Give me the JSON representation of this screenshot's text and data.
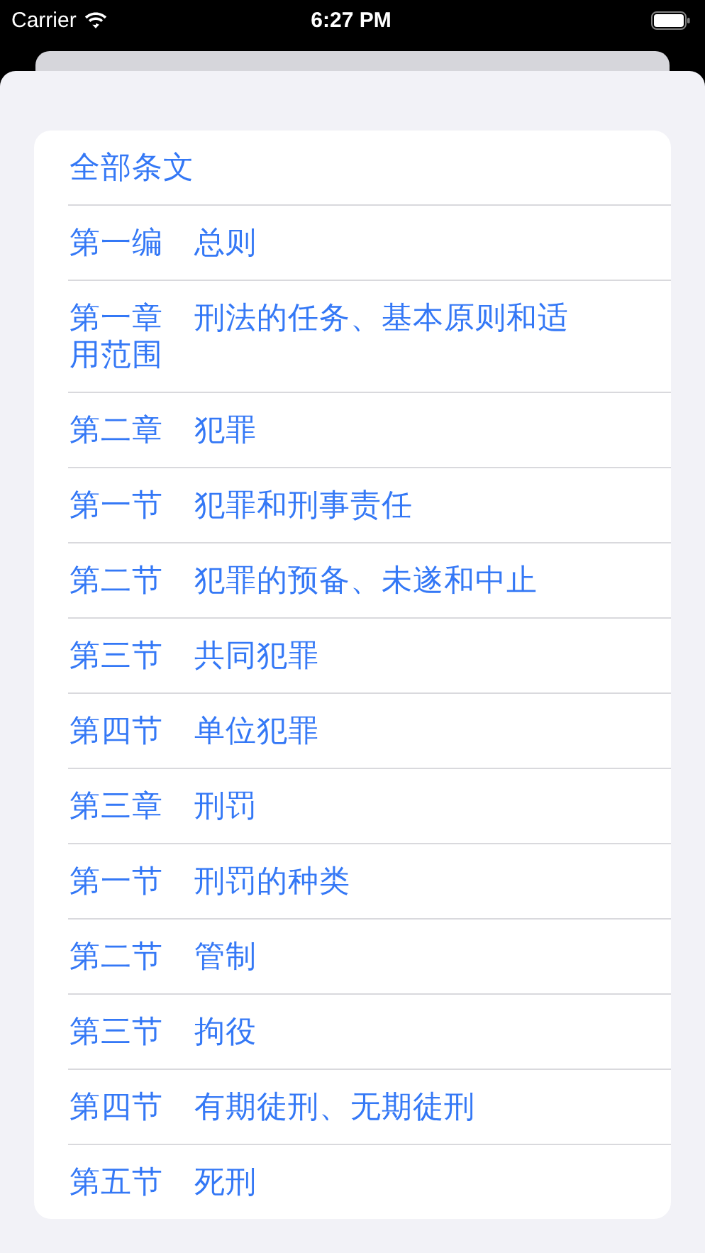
{
  "status_bar": {
    "carrier": "Carrier",
    "time": "6:27 PM"
  },
  "list": {
    "items": [
      {
        "label": "全部条文"
      },
      {
        "label": "第一编　总则"
      },
      {
        "label": "第一章　刑法的任务、基本原则和适用范围"
      },
      {
        "label": "第二章　犯罪"
      },
      {
        "label": "第一节　犯罪和刑事责任"
      },
      {
        "label": "第二节　犯罪的预备、未遂和中止"
      },
      {
        "label": "第三节　共同犯罪"
      },
      {
        "label": "第四节　单位犯罪"
      },
      {
        "label": "第三章　刑罚"
      },
      {
        "label": "第一节　刑罚的种类"
      },
      {
        "label": "第二节　管制"
      },
      {
        "label": "第三节　拘役"
      },
      {
        "label": "第四节　有期徒刑、无期徒刑"
      },
      {
        "label": "第五节　死刑"
      }
    ]
  }
}
